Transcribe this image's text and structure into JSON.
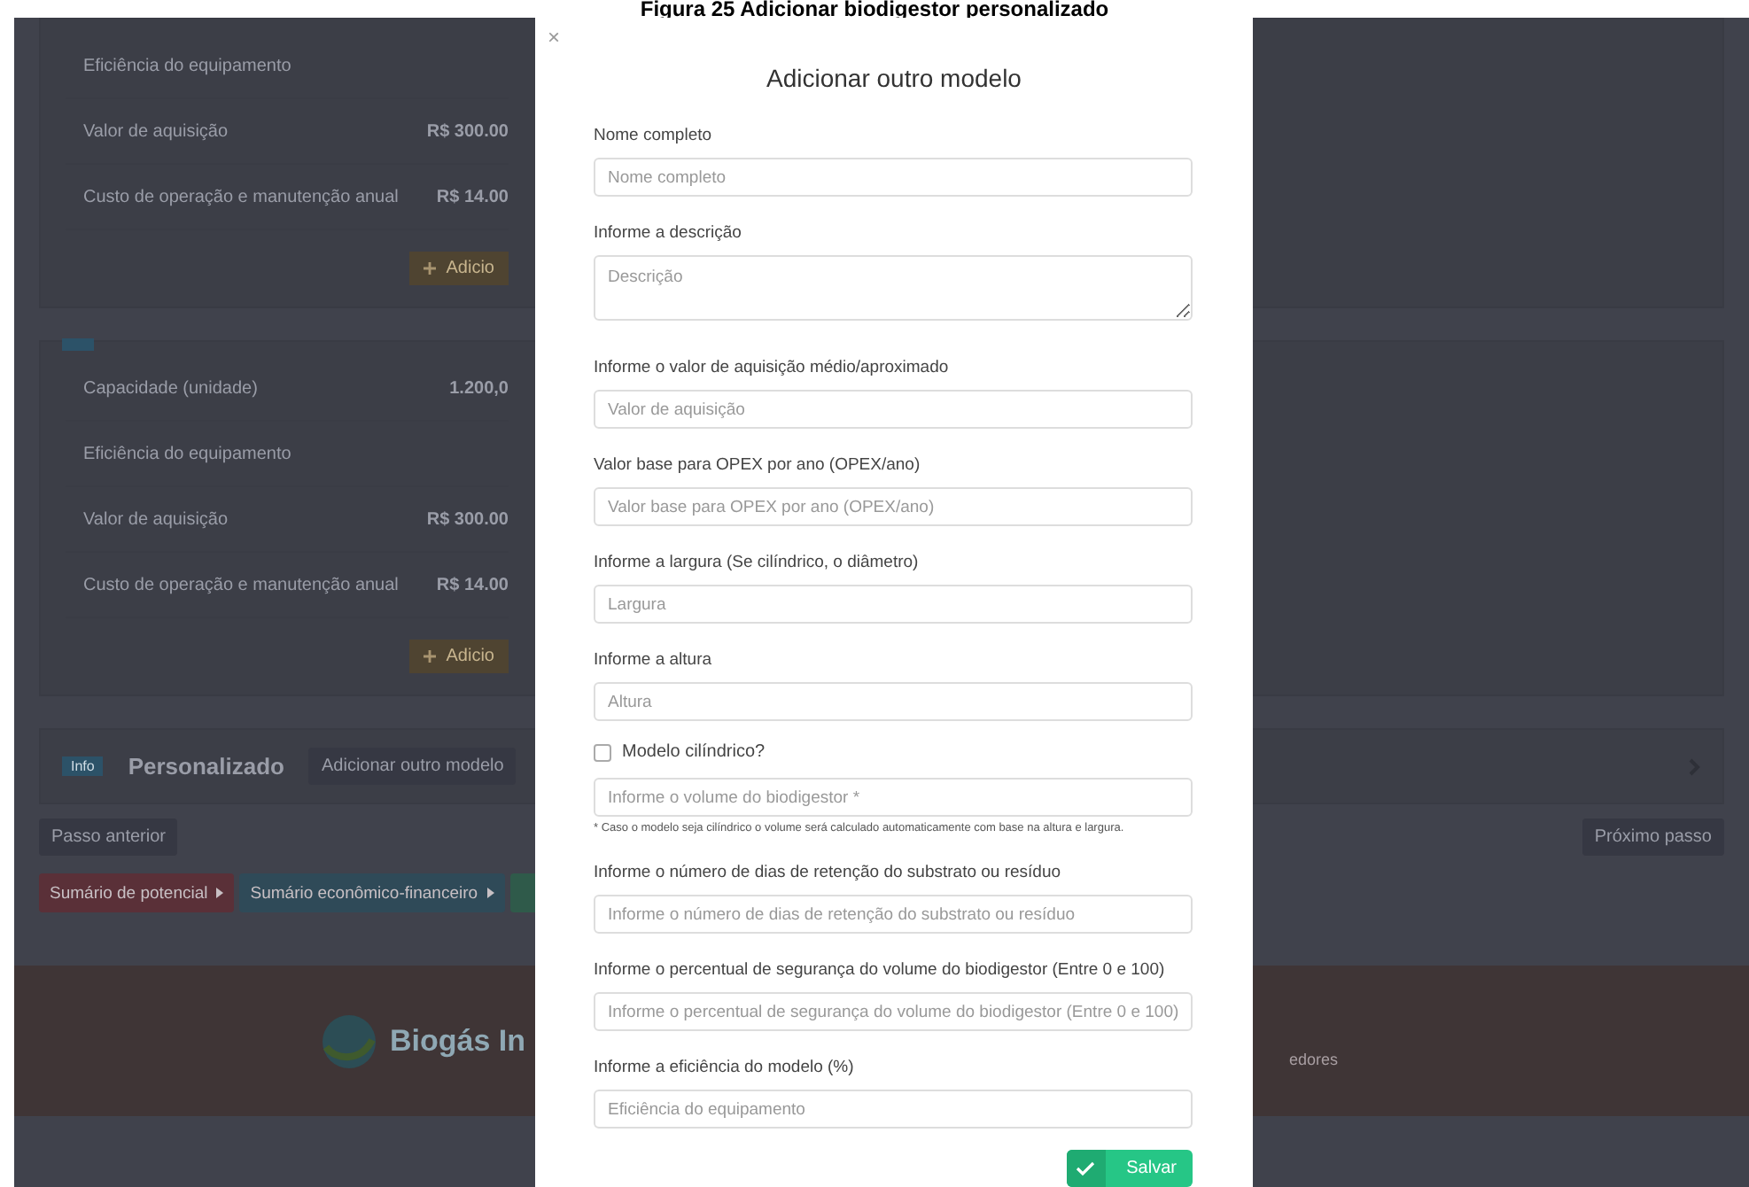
{
  "caption": "Figura 25 Adicionar biodigestor personalizado",
  "background": {
    "cards": [
      {
        "badge": false,
        "rows": [
          {
            "label": "Eficiência do equipamento",
            "value": ""
          },
          {
            "label": "Valor de aquisição",
            "value": "R$ 300.00"
          },
          {
            "label": "Custo de operação e manutenção anual",
            "value": "R$ 14.00"
          }
        ],
        "button": "Adicio"
      },
      {
        "badge": true,
        "rows": [
          {
            "label": "Capacidade (unidade)",
            "value": "1.200,0"
          },
          {
            "label": "Eficiência do equipamento",
            "value": ""
          },
          {
            "label": "Valor de aquisição",
            "value": "R$ 300.00"
          },
          {
            "label": "Custo de operação e manutenção anual",
            "value": "R$ 14.00"
          }
        ],
        "button": "Adicio"
      }
    ],
    "custom": {
      "badge": "Info",
      "title": "Personalizado",
      "button": "Adicionar outro modelo"
    },
    "prev_button": "Passo anterior",
    "next_button": "Próximo passo",
    "summaries": [
      {
        "label": "Sumário de potencial",
        "color": "#5a3038"
      },
      {
        "label": "Sumário econômico-financeiro",
        "color": "#2f4a58"
      },
      {
        "color": "#2f5a4a"
      }
    ],
    "footer": {
      "logo": "Biogás In",
      "text": "edores"
    }
  },
  "modal": {
    "close": "×",
    "title": "Adicionar outro modelo",
    "fields": [
      {
        "kind": "text",
        "label": "Nome completo",
        "placeholder": "Nome completo"
      },
      {
        "kind": "textarea",
        "label": "Informe a descrição",
        "placeholder": "Descrição"
      },
      {
        "kind": "text",
        "label": "Informe o valor de aquisição médio/aproximado",
        "placeholder": "Valor de aquisição"
      },
      {
        "kind": "text",
        "label": "Valor base para OPEX por ano (OPEX/ano)",
        "placeholder": "Valor base para OPEX por ano (OPEX/ano)"
      },
      {
        "kind": "text",
        "label": "Informe a largura (Se cilíndrico, o diâmetro)",
        "placeholder": "Largura"
      },
      {
        "kind": "text",
        "label": "Informe a altura",
        "placeholder": "Altura"
      },
      {
        "kind": "checkbox",
        "label": "Modelo cilíndrico?",
        "checked": false
      },
      {
        "kind": "text",
        "placeholder": "Informe o volume do biodigestor *",
        "note": "* Caso o modelo seja cilíndrico o volume será calculado automaticamente com base na altura e largura."
      },
      {
        "kind": "text",
        "label": "Informe o número de dias de retenção do substrato ou resíduo",
        "placeholder": "Informe o número de dias de retenção do substrato ou resíduo"
      },
      {
        "kind": "text",
        "label": "Informe o percentual de segurança do volume do biodigestor (Entre 0 e 100)",
        "placeholder": "Informe o percentual de segurança do volume do biodigestor (Entre 0 e 100)"
      },
      {
        "kind": "text",
        "label": "Informe a eficiência do modelo (%)",
        "placeholder": "Eficiência do equipamento"
      }
    ],
    "save": "Salvar"
  }
}
